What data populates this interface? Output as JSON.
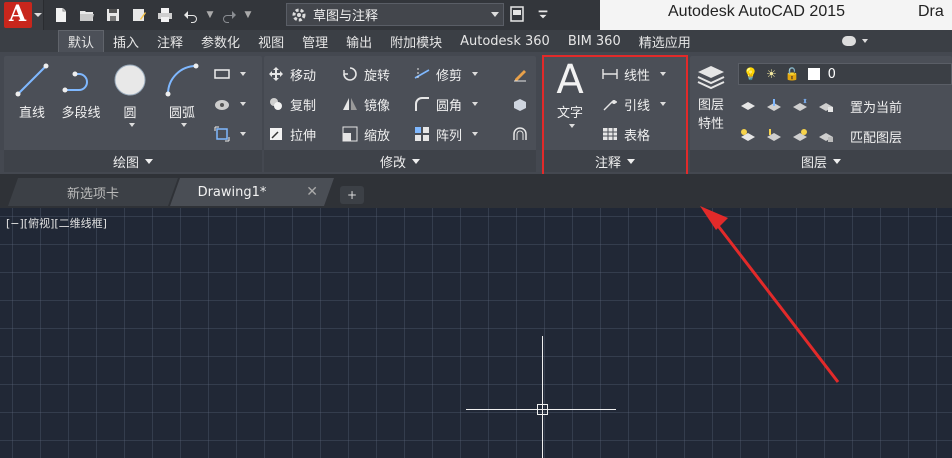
{
  "title_bar": {
    "app_title": "Autodesk AutoCAD 2015",
    "doc_title_partial": "Dra",
    "workspace": "草图与注释"
  },
  "ribbon_tabs": [
    {
      "label": "默认",
      "active": true
    },
    {
      "label": "插入"
    },
    {
      "label": "注释"
    },
    {
      "label": "参数化"
    },
    {
      "label": "视图"
    },
    {
      "label": "管理"
    },
    {
      "label": "输出"
    },
    {
      "label": "附加模块"
    },
    {
      "label": "Autodesk 360"
    },
    {
      "label": "BIM 360"
    },
    {
      "label": "精选应用"
    }
  ],
  "panels": {
    "draw": {
      "title": "绘图",
      "line": "直线",
      "polyline": "多段线",
      "circle": "圆",
      "arc": "圆弧"
    },
    "modify": {
      "title": "修改",
      "move": "移动",
      "rotate": "旋转",
      "trim": "修剪",
      "copy": "复制",
      "mirror": "镜像",
      "fillet": "圆角",
      "stretch": "拉伸",
      "scale": "缩放",
      "array": "阵列"
    },
    "annotation": {
      "title": "注释",
      "text": "文字",
      "dimension": "线性",
      "leader": "引线",
      "table": "表格"
    },
    "layers": {
      "title": "图层",
      "properties_line1": "图层",
      "properties_line2": "特性",
      "layer_name": "0",
      "set_current": "置为当前",
      "match_layer": "匹配图层"
    }
  },
  "document_tabs": {
    "new_tab": "新选项卡",
    "active": "Drawing1*",
    "add_symbol": "+"
  },
  "viewport": {
    "label": "[−][俯视][二维线框]"
  },
  "colors": {
    "highlight": "#e22a2a",
    "logo": "#c8261c",
    "canvas": "#212836"
  }
}
